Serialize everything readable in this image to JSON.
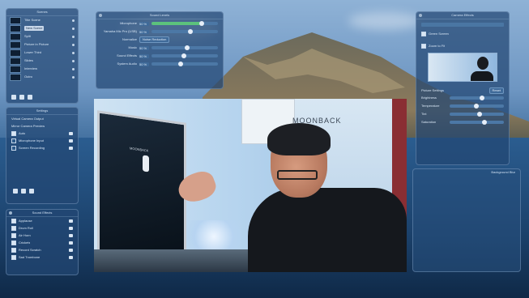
{
  "left_top_panel": {
    "title": "Scenes",
    "items": [
      {
        "label": "Title Scene"
      },
      {
        "label": "Main Camera"
      },
      {
        "label": "Split"
      },
      {
        "label": "Picture in Picture"
      },
      {
        "label": "Lower Third"
      },
      {
        "label": "Slides"
      },
      {
        "label": "Interview"
      },
      {
        "label": "Outro"
      }
    ],
    "tooltip": "New Scene"
  },
  "left_mid_panel": {
    "title": "Settings",
    "rows": [
      {
        "label": "Virtual Camera Output"
      },
      {
        "label": "Mirror Camera Preview"
      },
      {
        "label": "Auto"
      },
      {
        "label": "Microphone Input"
      },
      {
        "label": "Screen Recording"
      }
    ]
  },
  "left_bottom_panel": {
    "title": "Sound Effects",
    "items": [
      {
        "label": "Applause"
      },
      {
        "label": "Drum Roll"
      },
      {
        "label": "Air Horn"
      },
      {
        "label": "Crickets"
      },
      {
        "label": "Record Scratch"
      },
      {
        "label": "Sad Trombone"
      }
    ]
  },
  "top_center_panel": {
    "title": "Sound Levels",
    "rows": [
      {
        "label": "Microphone",
        "value": "50 %",
        "level": 0.75,
        "green": true
      },
      {
        "label": "Yamaha Mic Pro (USB)",
        "value": "50 %",
        "level": 0.55
      },
      {
        "label": "Normalize",
        "value": "",
        "level": 0,
        "button": "Noise Reduction"
      },
      {
        "label": "Music",
        "value": "50 %",
        "level": 0.5
      },
      {
        "label": "Sound Effects",
        "value": "50 %",
        "level": 0.45
      },
      {
        "label": "System Audio",
        "value": "50 %",
        "level": 0.4
      }
    ]
  },
  "right_panel": {
    "title": "Camera Effects",
    "option_greenscreen": "Green Screen",
    "option_zoom": "Zoom to Fit",
    "section": "Picture Settings",
    "reset": "Reset",
    "sliders": [
      {
        "label": "Brightness",
        "level": 0.55
      },
      {
        "label": "Temperature",
        "level": 0.45
      },
      {
        "label": "Tint",
        "level": 0.5
      },
      {
        "label": "Saturation",
        "level": 0.6
      }
    ]
  },
  "right_bottom_panel": {
    "title": "Background Blur"
  },
  "video": {
    "logo": "MOONBACK",
    "monitor_text": "MOONBACK"
  }
}
